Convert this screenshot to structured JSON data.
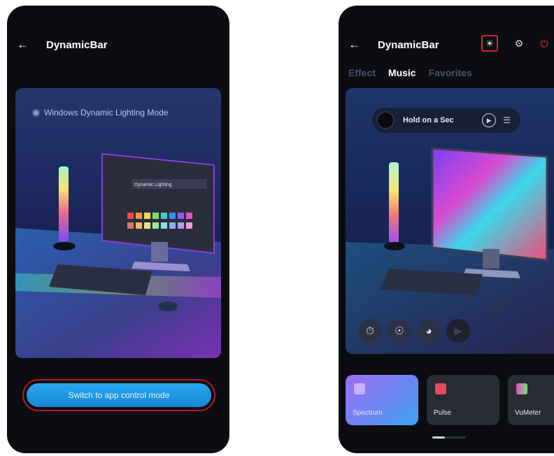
{
  "left_screen": {
    "title": "DynamicBar",
    "back_icon": "arrow-left-icon",
    "mode_label": "Windows Dynamic Lighting Mode",
    "monitor_panel_title": "Dynamic Lighting",
    "switch_button_label": "Switch to app control mode"
  },
  "right_screen": {
    "title": "DynamicBar",
    "back_icon": "arrow-left-icon",
    "toolbar_icons": [
      "sun-icon",
      "gear-icon",
      "power-icon"
    ],
    "tabs": [
      {
        "label": "Effect",
        "active": false
      },
      {
        "label": "Music",
        "active": true
      },
      {
        "label": "Favorites",
        "active": false
      }
    ],
    "now_playing": {
      "title": "Hold on a Sec",
      "play_icon": "play-icon",
      "list_icon": "playlist-icon"
    },
    "controls": [
      "timer-icon",
      "mic-icon",
      "headphones-icon",
      "play-icon"
    ],
    "modes": [
      {
        "label": "Spectrum",
        "icon": "spectrum-icon",
        "active": true
      },
      {
        "label": "Pulse",
        "icon": "pulse-icon",
        "active": false
      },
      {
        "label": "VuMeter",
        "icon": "vumeter-icon",
        "active": false
      }
    ]
  },
  "colors": {
    "accent_blue": "#1e90e6",
    "highlight_red": "#d8242e",
    "phone_bg": "#0c0d12"
  }
}
